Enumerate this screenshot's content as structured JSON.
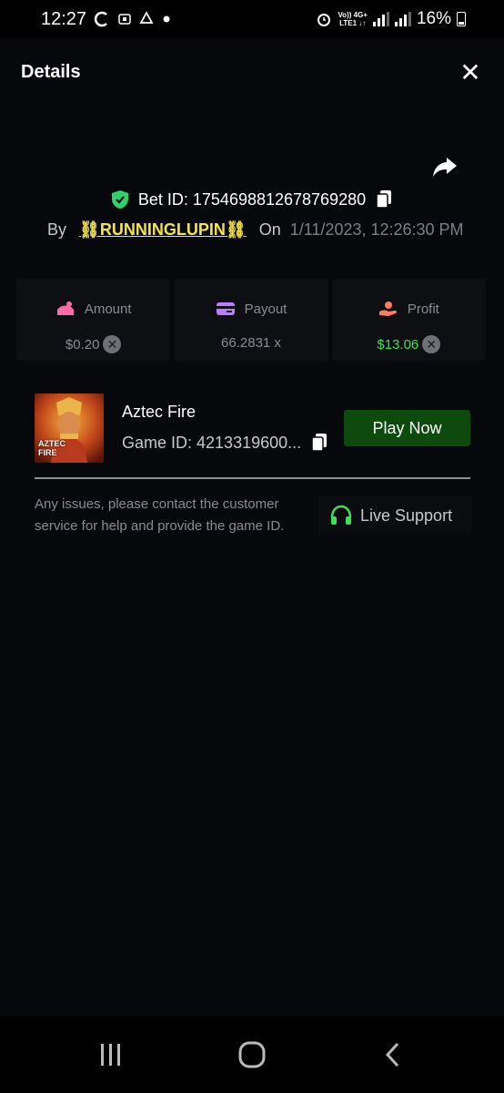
{
  "status_bar": {
    "time": "12:27",
    "left_icons": [
      "sync-icon",
      "notification-icon",
      "recycle-icon",
      "dot-icon"
    ],
    "network_top": "Vo)) 4G+",
    "network_bottom": "LTE1 ↓↑",
    "battery": "16%"
  },
  "header": {
    "title": "Details",
    "close_icon": "close-icon",
    "share_icon": "share-icon"
  },
  "bet": {
    "bet_id_label": "Bet ID: 1754698812678769280",
    "by_label": "By",
    "username": "⛓RUNNINGLUPIN⛓",
    "on_label": "On",
    "date": "1/11/2023, 12:26:30 PM"
  },
  "stats": [
    {
      "label": "Amount",
      "value": "$0.20",
      "icon": "amount-icon",
      "color": "#ff6aa8"
    },
    {
      "label": "Payout",
      "value": "66.2831 x",
      "icon": "card-icon",
      "color": "#c07cff"
    },
    {
      "label": "Profit",
      "value": "$13.06",
      "icon": "hand-coin-icon",
      "color": "#ff7b62"
    }
  ],
  "game": {
    "name": "Aztec Fire",
    "id_label": "Game ID: 4213319600...",
    "thumb_text": "AZTEC FIRE",
    "play_label": "Play Now"
  },
  "support": {
    "text": "Any issues, please contact the customer service for help and provide the game ID.",
    "button_label": "Live Support"
  },
  "colors": {
    "accent_green": "#3ee05a",
    "play_button": "#0c4a0d",
    "username": "#f5e44a",
    "shield": "#2ed46b"
  }
}
